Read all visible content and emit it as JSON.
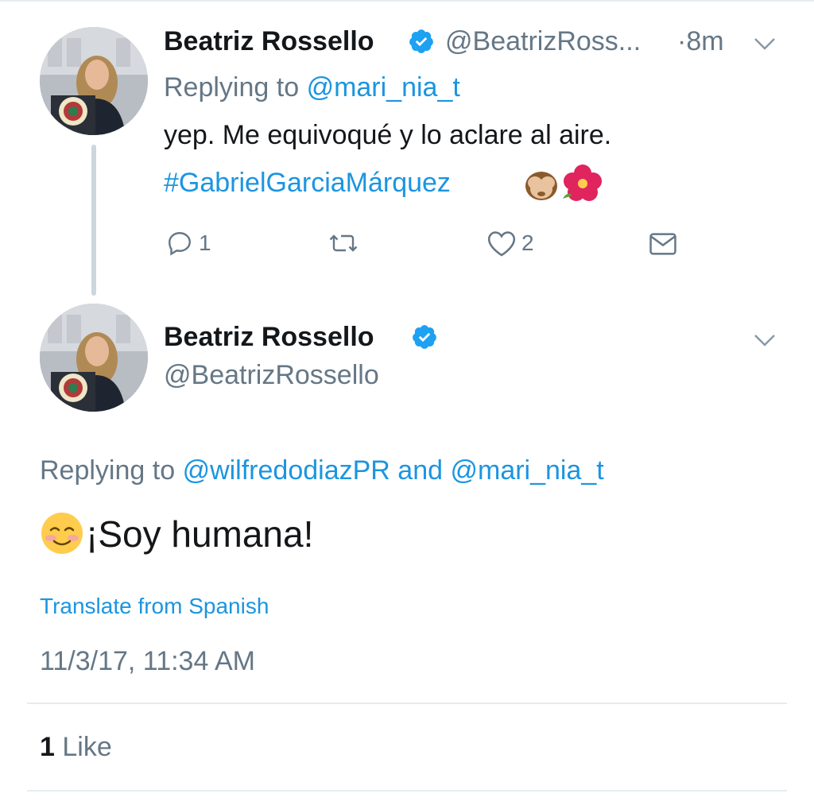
{
  "parent_tweet": {
    "display_name": "Beatriz Rossello",
    "handle": "@BeatrizRoss...",
    "time": "·8m",
    "replying_prefix": "Replying to",
    "replying_handle": "@mari_nia_t",
    "text": "yep. Me equivoqué y lo aclare al aire.",
    "hashtag": "#GabrielGarciaMárquez",
    "emojis": [
      "see-no-evil-monkey-icon",
      "hibiscus-icon"
    ],
    "actions": {
      "reply_count": "1",
      "retweet_count": "",
      "like_count": "2"
    }
  },
  "main_tweet": {
    "display_name": "Beatriz Rossello",
    "handle": "@BeatrizRossello",
    "replying_prefix": "Replying to",
    "replying_handle_1": "@wilfredodiazPR",
    "replying_and": "and",
    "replying_handle_2": "@mari_nia_t",
    "emoji": "smiling-face-icon",
    "text": "¡Soy humana!",
    "translate_label": "Translate from Spanish",
    "timestamp": "11/3/17, 11:34 AM",
    "like_count": "1",
    "like_label": "Like"
  },
  "colors": {
    "link": "#1b95e0",
    "secondary_text": "#657786",
    "verified": "#1da1f2",
    "divider": "#e6ecf0"
  }
}
